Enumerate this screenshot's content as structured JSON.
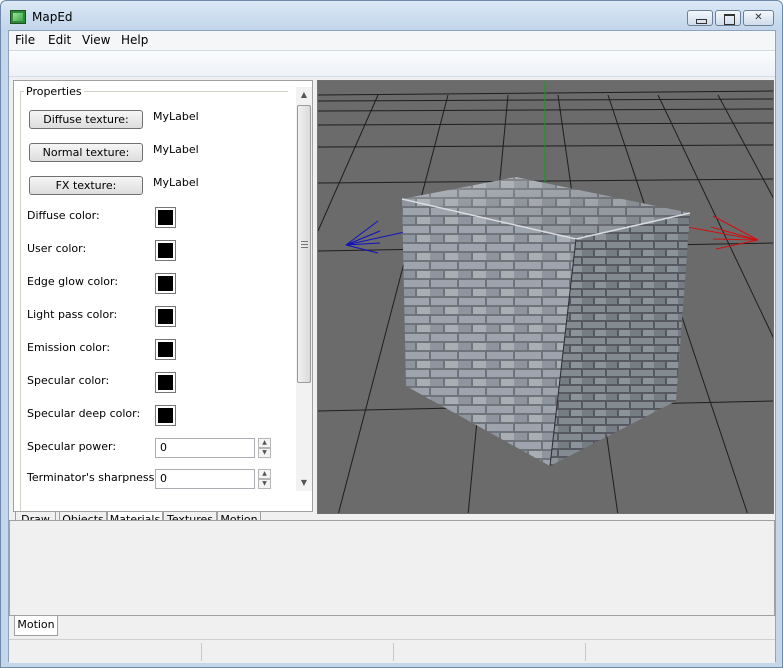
{
  "window": {
    "title": "MapEd"
  },
  "menu": [
    "File",
    "Edit",
    "View",
    "Help"
  ],
  "properties": {
    "group_title": "Properties",
    "buttons": [
      {
        "label": "Diffuse texture:",
        "value": "MyLabel"
      },
      {
        "label": "Normal texture:",
        "value": "MyLabel"
      },
      {
        "label": "FX texture:",
        "value": "MyLabel"
      }
    ],
    "colors": [
      {
        "label": "Diffuse color:",
        "color": "#000000"
      },
      {
        "label": "User color:",
        "color": "#000000"
      },
      {
        "label": "Edge glow color:",
        "color": "#000000"
      },
      {
        "label": "Light pass color:",
        "color": "#000000"
      },
      {
        "label": "Emission color:",
        "color": "#000000"
      },
      {
        "label": "Specular color:",
        "color": "#000000"
      },
      {
        "label": "Specular deep color:",
        "color": "#000000"
      }
    ],
    "spinners": [
      {
        "label": "Specular power:",
        "value": "0"
      },
      {
        "label": "Terminator's sharpness:",
        "value": "0"
      }
    ]
  },
  "left_tabs": [
    "Draw",
    "Objects",
    "Materials",
    "Textures",
    "Motion"
  ],
  "active_left_tab": "Materials",
  "bottom_tab": "Motion",
  "viewport": {
    "axis_colors": {
      "x": "#d01010",
      "y": "#10a010",
      "z": "#1010c0"
    },
    "background": "#6b6b6b"
  }
}
